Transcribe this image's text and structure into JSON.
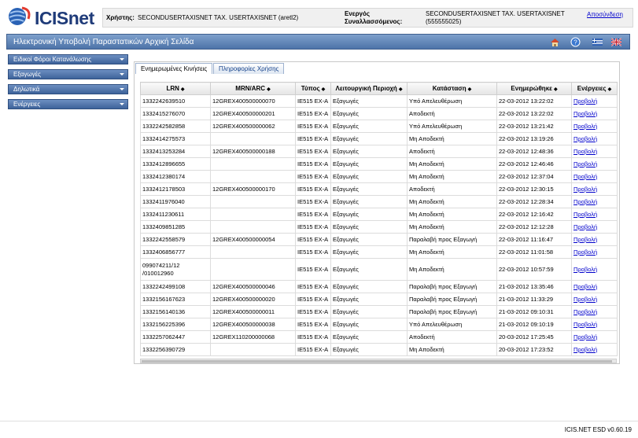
{
  "header": {
    "logo_text": "ICISnet",
    "user_label": "Χρήστης:",
    "user_value": "SECONDUSERTAXISNET TAX. USERTAXISNET (aretl2)",
    "partner_label_1": "Ενεργός",
    "partner_label_2": "Συναλλασσόμενος:",
    "partner_value_1": "SECONDUSERTAXISNET TAX. USERTAXISNET",
    "partner_value_2": "(555555025)",
    "logout": "Αποσύνδεση"
  },
  "title_bar": {
    "title": "Ηλεκτρονική Υποβολή Παραστατικών Αρχική Σελίδα",
    "icons": [
      "home-icon",
      "help-icon",
      "flag-greek-icon",
      "flag-uk-icon"
    ]
  },
  "nav": {
    "items": [
      {
        "label": "Ειδικοί Φόροι Κατανάλωσης"
      },
      {
        "label": "Εξαγωγές"
      },
      {
        "label": "Δηλωτικά"
      },
      {
        "label": "Ενέργειες"
      }
    ]
  },
  "tabs": [
    {
      "label": "Ενημερωμένες Κινήσεις",
      "active": true
    },
    {
      "label": "Πληροφορίες Χρήσης",
      "active": false
    }
  ],
  "grid": {
    "columns": [
      "LRN",
      "MRN/ARC",
      "Τύπος",
      "Λειτουργική Περιοχή",
      "Κατάσταση",
      "Ενημερώθηκε",
      "Ενέργειες"
    ],
    "rows": [
      {
        "lrn": "1332242639510",
        "mrn": "12GREX400500000070",
        "type": "IE515 EX-A",
        "area": "Εξαγωγές",
        "status": "Υπό Απελευθέρωση",
        "updated": "22-03-2012 13:22:02",
        "action": "Προβολή"
      },
      {
        "lrn": "1332415276070",
        "mrn": "12GREX400500000201",
        "type": "IE515 EX-A",
        "area": "Εξαγωγές",
        "status": "Αποδεκτή",
        "updated": "22-03-2012 13:22:02",
        "action": "Προβολή"
      },
      {
        "lrn": "1332242582858",
        "mrn": "12GREX400500000062",
        "type": "IE515 EX-A",
        "area": "Εξαγωγές",
        "status": "Υπό Απελευθέρωση",
        "updated": "22-03-2012 13:21:42",
        "action": "Προβολή"
      },
      {
        "lrn": "1332414275573",
        "mrn": "",
        "type": "IE515 EX-A",
        "area": "Εξαγωγές",
        "status": "Μη Αποδεκτή",
        "updated": "22-03-2012 13:19:26",
        "action": "Προβολή"
      },
      {
        "lrn": "1332413253284",
        "mrn": "12GREX400500000188",
        "type": "IE515 EX-A",
        "area": "Εξαγωγές",
        "status": "Αποδεκτή",
        "updated": "22-03-2012 12:48:36",
        "action": "Προβολή"
      },
      {
        "lrn": "1332412896655",
        "mrn": "",
        "type": "IE515 EX-A",
        "area": "Εξαγωγές",
        "status": "Μη Αποδεκτή",
        "updated": "22-03-2012 12:46:46",
        "action": "Προβολή"
      },
      {
        "lrn": "1332412380174",
        "mrn": "",
        "type": "IE515 EX-A",
        "area": "Εξαγωγές",
        "status": "Μη Αποδεκτή",
        "updated": "22-03-2012 12:37:04",
        "action": "Προβολή"
      },
      {
        "lrn": "1332412178503",
        "mrn": "12GREX400500000170",
        "type": "IE515 EX-A",
        "area": "Εξαγωγές",
        "status": "Αποδεκτή",
        "updated": "22-03-2012 12:30:15",
        "action": "Προβολή"
      },
      {
        "lrn": "1332411976040",
        "mrn": "",
        "type": "IE515 EX-A",
        "area": "Εξαγωγές",
        "status": "Μη Αποδεκτή",
        "updated": "22-03-2012 12:28:34",
        "action": "Προβολή"
      },
      {
        "lrn": "1332411230611",
        "mrn": "",
        "type": "IE515 EX-A",
        "area": "Εξαγωγές",
        "status": "Μη Αποδεκτή",
        "updated": "22-03-2012 12:16:42",
        "action": "Προβολή"
      },
      {
        "lrn": "1332409851285",
        "mrn": "",
        "type": "IE515 EX-A",
        "area": "Εξαγωγές",
        "status": "Μη Αποδεκτή",
        "updated": "22-03-2012 12:12:28",
        "action": "Προβολή"
      },
      {
        "lrn": "1332242558579",
        "mrn": "12GREX400500000054",
        "type": "IE515 EX-A",
        "area": "Εξαγωγές",
        "status": "Παραλαβή προς Εξαγωγή",
        "updated": "22-03-2012 11:16:47",
        "action": "Προβολή"
      },
      {
        "lrn": "1332406856777",
        "mrn": "",
        "type": "IE515 EX-A",
        "area": "Εξαγωγές",
        "status": "Μη Αποδεκτή",
        "updated": "22-03-2012 11:01:58",
        "action": "Προβολή"
      },
      {
        "lrn": "099074211/12 /010012960",
        "mrn": "",
        "type": "IE515 EX-A",
        "area": "Εξαγωγές",
        "status": "Μη Αποδεκτή",
        "updated": "22-03-2012 10:57:59",
        "action": "Προβολή",
        "tall": true
      },
      {
        "lrn": "1332242499108",
        "mrn": "12GREX400500000046",
        "type": "IE515 EX-A",
        "area": "Εξαγωγές",
        "status": "Παραλαβή προς Εξαγωγή",
        "updated": "21-03-2012 13:35:46",
        "action": "Προβολή"
      },
      {
        "lrn": "1332156167623",
        "mrn": "12GREX400500000020",
        "type": "IE515 EX-A",
        "area": "Εξαγωγές",
        "status": "Παραλαβή προς Εξαγωγή",
        "updated": "21-03-2012 11:33:29",
        "action": "Προβολή"
      },
      {
        "lrn": "1332156140136",
        "mrn": "12GREX400500000011",
        "type": "IE515 EX-A",
        "area": "Εξαγωγές",
        "status": "Παραλαβή προς Εξαγωγή",
        "updated": "21-03-2012 09:10:31",
        "action": "Προβολή"
      },
      {
        "lrn": "1332156225396",
        "mrn": "12GREX400500000038",
        "type": "IE515 EX-A",
        "area": "Εξαγωγές",
        "status": "Υπό Απελευθέρωση",
        "updated": "21-03-2012 09:10:19",
        "action": "Προβολή"
      },
      {
        "lrn": "1332257062447",
        "mrn": "12GREX110200000068",
        "type": "IE515 EX-A",
        "area": "Εξαγωγές",
        "status": "Αποδεκτή",
        "updated": "20-03-2012 17:25:45",
        "action": "Προβολή"
      },
      {
        "lrn": "1332256390729",
        "mrn": "",
        "type": "IE515 EX-A",
        "area": "Εξαγωγές",
        "status": "Μη Αποδεκτή",
        "updated": "20-03-2012 17:23:52",
        "action": "Προβολή"
      }
    ]
  },
  "footer": {
    "version": "ICIS.NET ESD v0.60.19"
  }
}
